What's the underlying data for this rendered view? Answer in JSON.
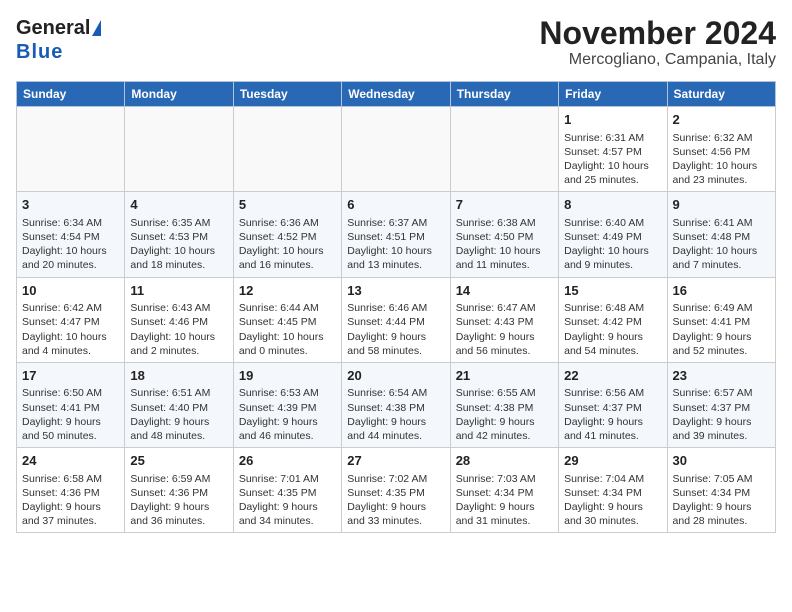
{
  "header": {
    "logo_general": "General",
    "logo_blue": "Blue",
    "title": "November 2024",
    "subtitle": "Mercogliano, Campania, Italy"
  },
  "calendar": {
    "days_of_week": [
      "Sunday",
      "Monday",
      "Tuesday",
      "Wednesday",
      "Thursday",
      "Friday",
      "Saturday"
    ],
    "weeks": [
      [
        {
          "day": "",
          "content": ""
        },
        {
          "day": "",
          "content": ""
        },
        {
          "day": "",
          "content": ""
        },
        {
          "day": "",
          "content": ""
        },
        {
          "day": "",
          "content": ""
        },
        {
          "day": "1",
          "content": "Sunrise: 6:31 AM\nSunset: 4:57 PM\nDaylight: 10 hours and 25 minutes."
        },
        {
          "day": "2",
          "content": "Sunrise: 6:32 AM\nSunset: 4:56 PM\nDaylight: 10 hours and 23 minutes."
        }
      ],
      [
        {
          "day": "3",
          "content": "Sunrise: 6:34 AM\nSunset: 4:54 PM\nDaylight: 10 hours and 20 minutes."
        },
        {
          "day": "4",
          "content": "Sunrise: 6:35 AM\nSunset: 4:53 PM\nDaylight: 10 hours and 18 minutes."
        },
        {
          "day": "5",
          "content": "Sunrise: 6:36 AM\nSunset: 4:52 PM\nDaylight: 10 hours and 16 minutes."
        },
        {
          "day": "6",
          "content": "Sunrise: 6:37 AM\nSunset: 4:51 PM\nDaylight: 10 hours and 13 minutes."
        },
        {
          "day": "7",
          "content": "Sunrise: 6:38 AM\nSunset: 4:50 PM\nDaylight: 10 hours and 11 minutes."
        },
        {
          "day": "8",
          "content": "Sunrise: 6:40 AM\nSunset: 4:49 PM\nDaylight: 10 hours and 9 minutes."
        },
        {
          "day": "9",
          "content": "Sunrise: 6:41 AM\nSunset: 4:48 PM\nDaylight: 10 hours and 7 minutes."
        }
      ],
      [
        {
          "day": "10",
          "content": "Sunrise: 6:42 AM\nSunset: 4:47 PM\nDaylight: 10 hours and 4 minutes."
        },
        {
          "day": "11",
          "content": "Sunrise: 6:43 AM\nSunset: 4:46 PM\nDaylight: 10 hours and 2 minutes."
        },
        {
          "day": "12",
          "content": "Sunrise: 6:44 AM\nSunset: 4:45 PM\nDaylight: 10 hours and 0 minutes."
        },
        {
          "day": "13",
          "content": "Sunrise: 6:46 AM\nSunset: 4:44 PM\nDaylight: 9 hours and 58 minutes."
        },
        {
          "day": "14",
          "content": "Sunrise: 6:47 AM\nSunset: 4:43 PM\nDaylight: 9 hours and 56 minutes."
        },
        {
          "day": "15",
          "content": "Sunrise: 6:48 AM\nSunset: 4:42 PM\nDaylight: 9 hours and 54 minutes."
        },
        {
          "day": "16",
          "content": "Sunrise: 6:49 AM\nSunset: 4:41 PM\nDaylight: 9 hours and 52 minutes."
        }
      ],
      [
        {
          "day": "17",
          "content": "Sunrise: 6:50 AM\nSunset: 4:41 PM\nDaylight: 9 hours and 50 minutes."
        },
        {
          "day": "18",
          "content": "Sunrise: 6:51 AM\nSunset: 4:40 PM\nDaylight: 9 hours and 48 minutes."
        },
        {
          "day": "19",
          "content": "Sunrise: 6:53 AM\nSunset: 4:39 PM\nDaylight: 9 hours and 46 minutes."
        },
        {
          "day": "20",
          "content": "Sunrise: 6:54 AM\nSunset: 4:38 PM\nDaylight: 9 hours and 44 minutes."
        },
        {
          "day": "21",
          "content": "Sunrise: 6:55 AM\nSunset: 4:38 PM\nDaylight: 9 hours and 42 minutes."
        },
        {
          "day": "22",
          "content": "Sunrise: 6:56 AM\nSunset: 4:37 PM\nDaylight: 9 hours and 41 minutes."
        },
        {
          "day": "23",
          "content": "Sunrise: 6:57 AM\nSunset: 4:37 PM\nDaylight: 9 hours and 39 minutes."
        }
      ],
      [
        {
          "day": "24",
          "content": "Sunrise: 6:58 AM\nSunset: 4:36 PM\nDaylight: 9 hours and 37 minutes."
        },
        {
          "day": "25",
          "content": "Sunrise: 6:59 AM\nSunset: 4:36 PM\nDaylight: 9 hours and 36 minutes."
        },
        {
          "day": "26",
          "content": "Sunrise: 7:01 AM\nSunset: 4:35 PM\nDaylight: 9 hours and 34 minutes."
        },
        {
          "day": "27",
          "content": "Sunrise: 7:02 AM\nSunset: 4:35 PM\nDaylight: 9 hours and 33 minutes."
        },
        {
          "day": "28",
          "content": "Sunrise: 7:03 AM\nSunset: 4:34 PM\nDaylight: 9 hours and 31 minutes."
        },
        {
          "day": "29",
          "content": "Sunrise: 7:04 AM\nSunset: 4:34 PM\nDaylight: 9 hours and 30 minutes."
        },
        {
          "day": "30",
          "content": "Sunrise: 7:05 AM\nSunset: 4:34 PM\nDaylight: 9 hours and 28 minutes."
        }
      ]
    ]
  }
}
